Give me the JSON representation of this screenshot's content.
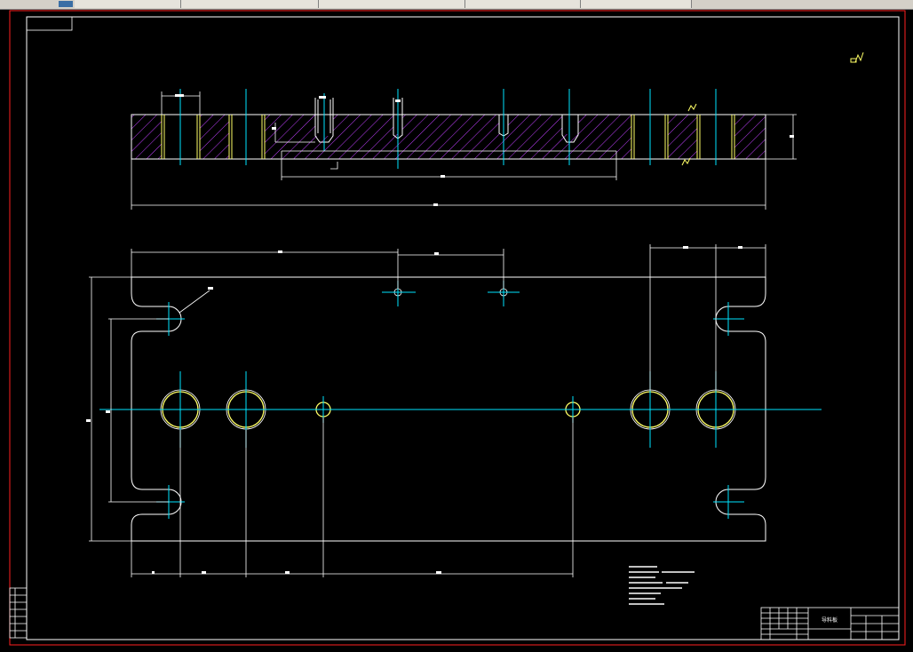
{
  "window": {
    "tabs": [
      "",
      "",
      "",
      "",
      "",
      ""
    ]
  },
  "drawing": {
    "background": "#000000",
    "border_color": "#ff2020",
    "line_color": "#ffffff",
    "center_line_color": "#00e5ff",
    "hole_color": "#ffff66",
    "hatch_color": "#c040ff"
  },
  "title_block": {
    "part_name": "导料板"
  }
}
